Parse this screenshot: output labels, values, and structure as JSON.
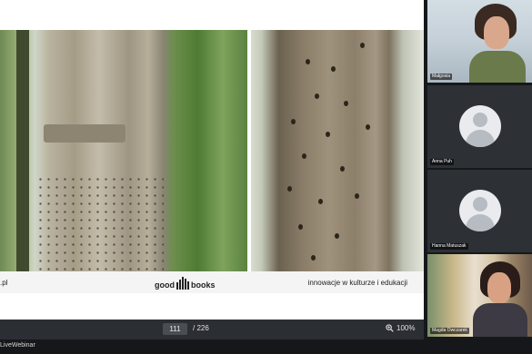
{
  "slide": {
    "site_fragment": ".pl",
    "logo": {
      "part1": "good",
      "part2": "books"
    },
    "tagline": "innowacje w kulturze i edukacji"
  },
  "pdf_toolbar": {
    "current_page": "111",
    "total_pages": "/ 226",
    "zoom": "100%",
    "zoom_icon": "zoom-in-icon"
  },
  "status": {
    "brand": "LiveWebinar"
  },
  "participants": [
    {
      "name": "Małgosia",
      "video": true
    },
    {
      "name": "Anna Puh",
      "video": false
    },
    {
      "name": "Hanna Matuszak",
      "video": false
    },
    {
      "name": "Magda Owczarek",
      "video": true
    }
  ],
  "colors": {
    "background": "#1f2227",
    "toolbar": "#2b2e33",
    "tile": "#2d3136"
  }
}
